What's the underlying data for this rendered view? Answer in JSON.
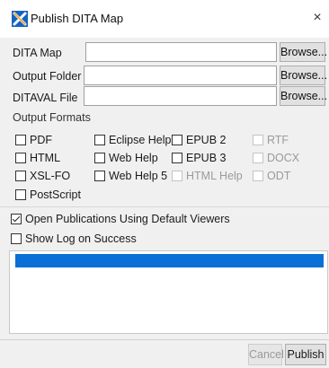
{
  "window": {
    "title": "Publish DITA Map",
    "close_glyph": "×",
    "icon": "oxygen-x-icon"
  },
  "fields": [
    {
      "label": "DITA Map",
      "value": "",
      "button": "Browse..."
    },
    {
      "label": "Output Folder",
      "value": "",
      "button": "Browse..."
    },
    {
      "label": "DITAVAL File",
      "value": "",
      "button": "Browse..."
    }
  ],
  "output_formats": {
    "label": "Output Formats",
    "items": [
      {
        "label": "PDF",
        "checked": false,
        "enabled": true
      },
      {
        "label": "Eclipse Help",
        "checked": false,
        "enabled": true
      },
      {
        "label": "EPUB 2",
        "checked": false,
        "enabled": true
      },
      {
        "label": "RTF",
        "checked": false,
        "enabled": false
      },
      {
        "label": "HTML",
        "checked": false,
        "enabled": true
      },
      {
        "label": "Web Help",
        "checked": false,
        "enabled": true
      },
      {
        "label": "EPUB 3",
        "checked": false,
        "enabled": true
      },
      {
        "label": "DOCX",
        "checked": false,
        "enabled": false
      },
      {
        "label": "XSL-FO",
        "checked": false,
        "enabled": true
      },
      {
        "label": "Web Help 5",
        "checked": false,
        "enabled": true
      },
      {
        "label": "HTML Help",
        "checked": false,
        "enabled": false
      },
      {
        "label": "ODT",
        "checked": false,
        "enabled": false
      },
      {
        "label": "PostScript",
        "checked": false,
        "enabled": true
      }
    ]
  },
  "options": {
    "open_publications": {
      "label": "Open Publications Using Default Viewers",
      "checked": true
    },
    "show_log": {
      "label": "Show Log on Success",
      "checked": false
    }
  },
  "progress": {
    "fraction": 1.0
  },
  "footer": {
    "cancel_label": "Cancel",
    "cancel_enabled": false,
    "publish_label": "Publish"
  },
  "colors": {
    "progress": "#0a6fd6",
    "accent": "#1565c0"
  }
}
